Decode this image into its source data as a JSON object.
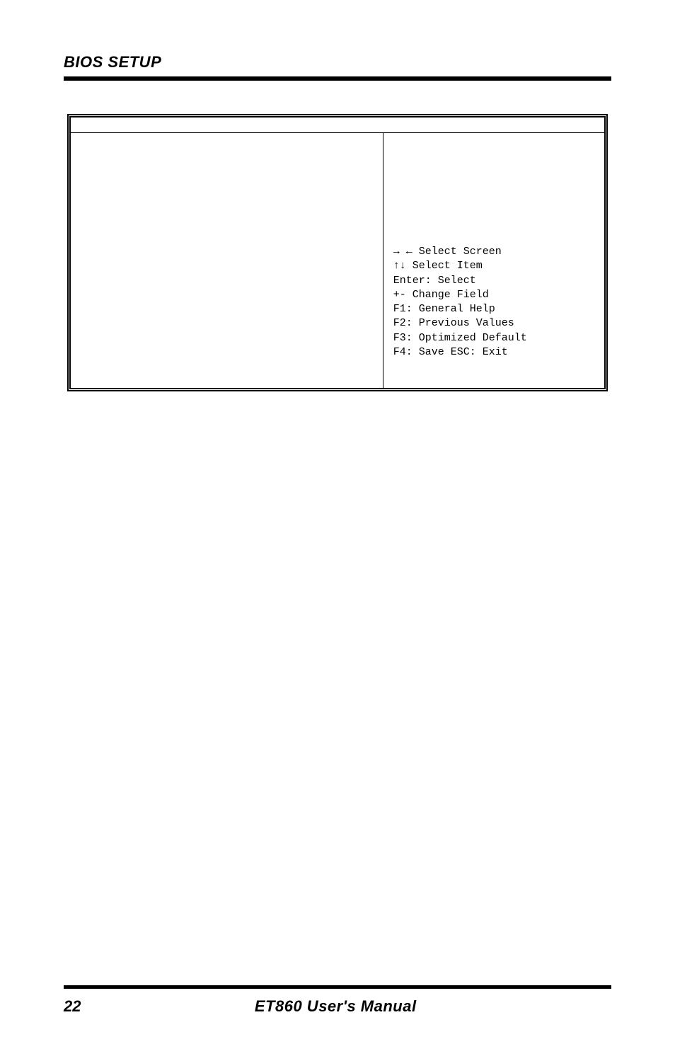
{
  "header": {
    "section_title": "BIOS SETUP"
  },
  "bios_help": {
    "line1": "→ ← Select Screen",
    "line2": "↑↓  Select Item",
    "line3": "Enter: Select",
    "line4": "+-   Change Field",
    "line5": "F1:  General Help",
    "line6": "F2:  Previous Values",
    "line7": "F3: Optimized Default",
    "line8": "F4: Save  ESC: Exit"
  },
  "footer": {
    "page_number": "22",
    "manual_title": "ET860 User's Manual"
  }
}
